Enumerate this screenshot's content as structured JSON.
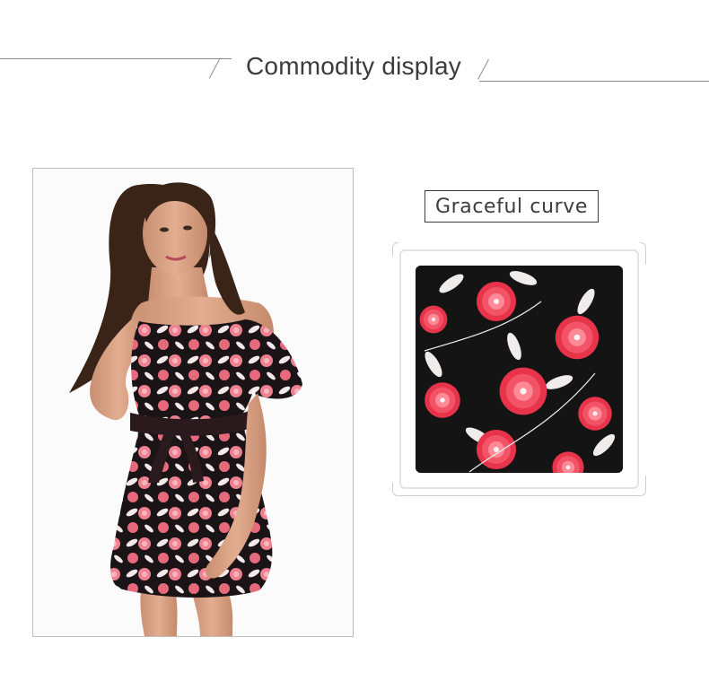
{
  "header": {
    "title": "Commodity display"
  },
  "caption": {
    "label": "Graceful curve"
  },
  "colors": {
    "text": "#3c3c3c",
    "rule": "#8a8a8a",
    "print_red": "#e8344a",
    "print_pink": "#f08a9a",
    "print_dark": "#141414"
  }
}
